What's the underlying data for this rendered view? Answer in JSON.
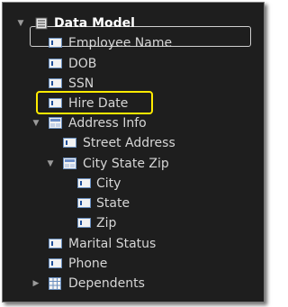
{
  "tree": {
    "root": {
      "label": "Data Model",
      "icon": "model-icon",
      "expanded": true
    },
    "items": [
      {
        "label": "Employee Name",
        "icon": "field-icon"
      },
      {
        "label": "DOB",
        "icon": "field-icon"
      },
      {
        "label": "SSN",
        "icon": "field-icon"
      },
      {
        "label": "Hire Date",
        "icon": "field-icon",
        "highlighted": true
      },
      {
        "label": "Address Info",
        "icon": "group-icon",
        "expanded": true
      },
      {
        "label": "Street Address",
        "icon": "field-icon"
      },
      {
        "label": "City State Zip",
        "icon": "group-icon",
        "expanded": true
      },
      {
        "label": "City",
        "icon": "field-icon"
      },
      {
        "label": "State",
        "icon": "field-icon"
      },
      {
        "label": "Zip",
        "icon": "field-icon"
      },
      {
        "label": "Marital Status",
        "icon": "field-icon"
      },
      {
        "label": "Phone",
        "icon": "field-icon"
      },
      {
        "label": "Dependents",
        "icon": "grid-icon",
        "expanded": false
      }
    ]
  },
  "colors": {
    "background": "#1e1e1e",
    "text": "#d6d6d6",
    "highlight": "#ffeb00"
  }
}
